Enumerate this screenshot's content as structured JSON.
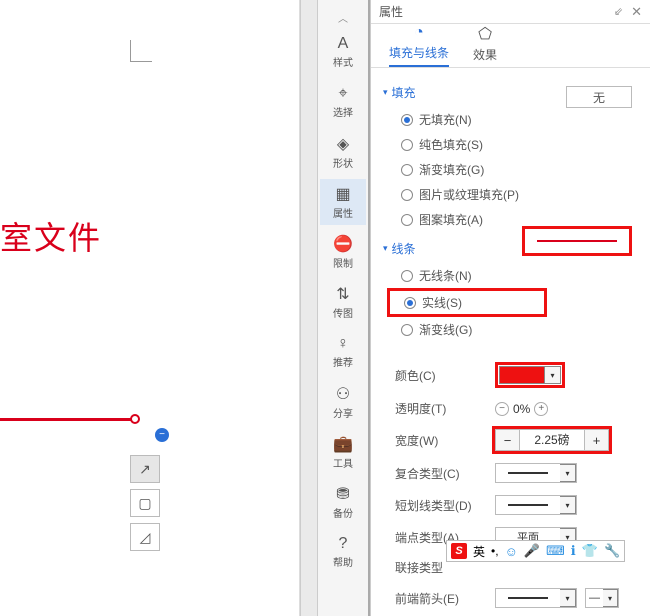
{
  "document": {
    "visible_text": "室文件"
  },
  "sidebar": {
    "items": [
      {
        "icon": "A",
        "label": "样式"
      },
      {
        "icon": "⌖",
        "label": "选择"
      },
      {
        "icon": "◈",
        "label": "形状"
      },
      {
        "icon": "▦",
        "label": "属性"
      },
      {
        "icon": "⛔",
        "label": "限制"
      },
      {
        "icon": "⇅",
        "label": "传图"
      },
      {
        "icon": "♀",
        "label": "推荐"
      },
      {
        "icon": "⚇",
        "label": "分享"
      },
      {
        "icon": "💼",
        "label": "工具"
      },
      {
        "icon": "⛃",
        "label": "备份"
      },
      {
        "icon": "?",
        "label": "帮助"
      }
    ]
  },
  "panel": {
    "title": "属性",
    "tabs": {
      "fill_line": "填充与线条",
      "effect": "效果"
    },
    "fill": {
      "header": "填充",
      "none_swatch": "无",
      "options": {
        "no_fill": "无填充(N)",
        "solid": "纯色填充(S)",
        "gradient": "渐变填充(G)",
        "picture": "图片或纹理填充(P)",
        "pattern": "图案填充(A)"
      }
    },
    "line": {
      "header": "线条",
      "options": {
        "none": "无线条(N)",
        "solid": "实线(S)",
        "gradient": "渐变线(G)"
      }
    },
    "props": {
      "color_label": "颜色(C)",
      "opacity_label": "透明度(T)",
      "opacity_value": "0%",
      "width_label": "宽度(W)",
      "width_value": "2.25磅",
      "compound_label": "复合类型(C)",
      "dash_label": "短划线类型(D)",
      "cap_label": "端点类型(A)",
      "cap_value": "平面",
      "join_label": "联接类型",
      "arrow_front_label": "前端箭头(E)"
    }
  },
  "ime": {
    "logo": "S",
    "lang": "英",
    "mode": "•,"
  }
}
